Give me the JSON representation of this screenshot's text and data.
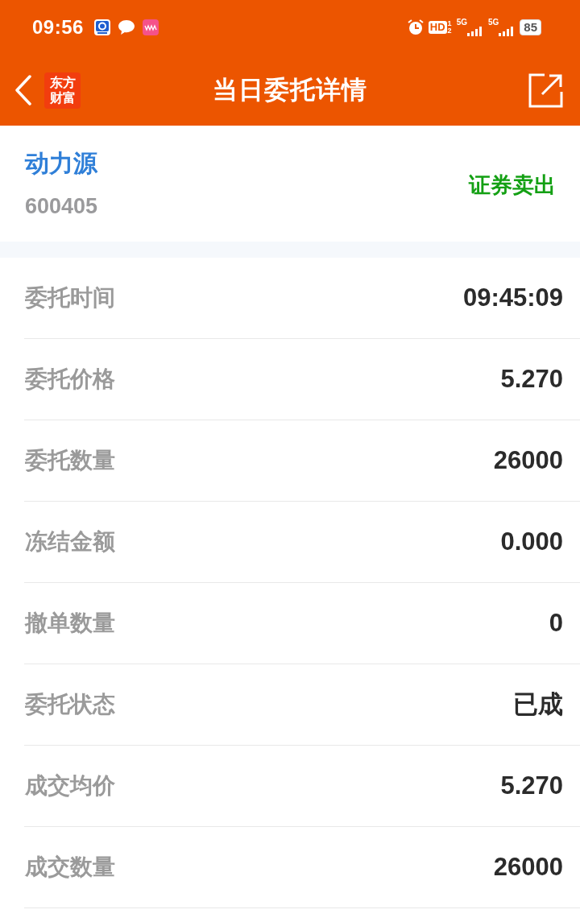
{
  "status_bar": {
    "time": "09:56",
    "hd_badge": {
      "label": "HD",
      "sims": [
        "1",
        "2"
      ]
    },
    "networks": [
      {
        "label": "5G"
      },
      {
        "label": "5G"
      }
    ],
    "battery": "85"
  },
  "header": {
    "logo": [
      "东方",
      "财富"
    ],
    "title": "当日委托详情"
  },
  "stock": {
    "name": "动力源",
    "code": "600405",
    "trade_type": {
      "label": "证券卖出",
      "kind": "sell"
    }
  },
  "details": [
    {
      "label": "委托时间",
      "value": "09:45:09"
    },
    {
      "label": "委托价格",
      "value": "5.270"
    },
    {
      "label": "委托数量",
      "value": "26000"
    },
    {
      "label": "冻结金额",
      "value": "0.000"
    },
    {
      "label": "撤单数量",
      "value": "0"
    },
    {
      "label": "委托状态",
      "value": "已成"
    },
    {
      "label": "成交均价",
      "value": "5.270"
    },
    {
      "label": "成交数量",
      "value": "26000"
    }
  ]
}
